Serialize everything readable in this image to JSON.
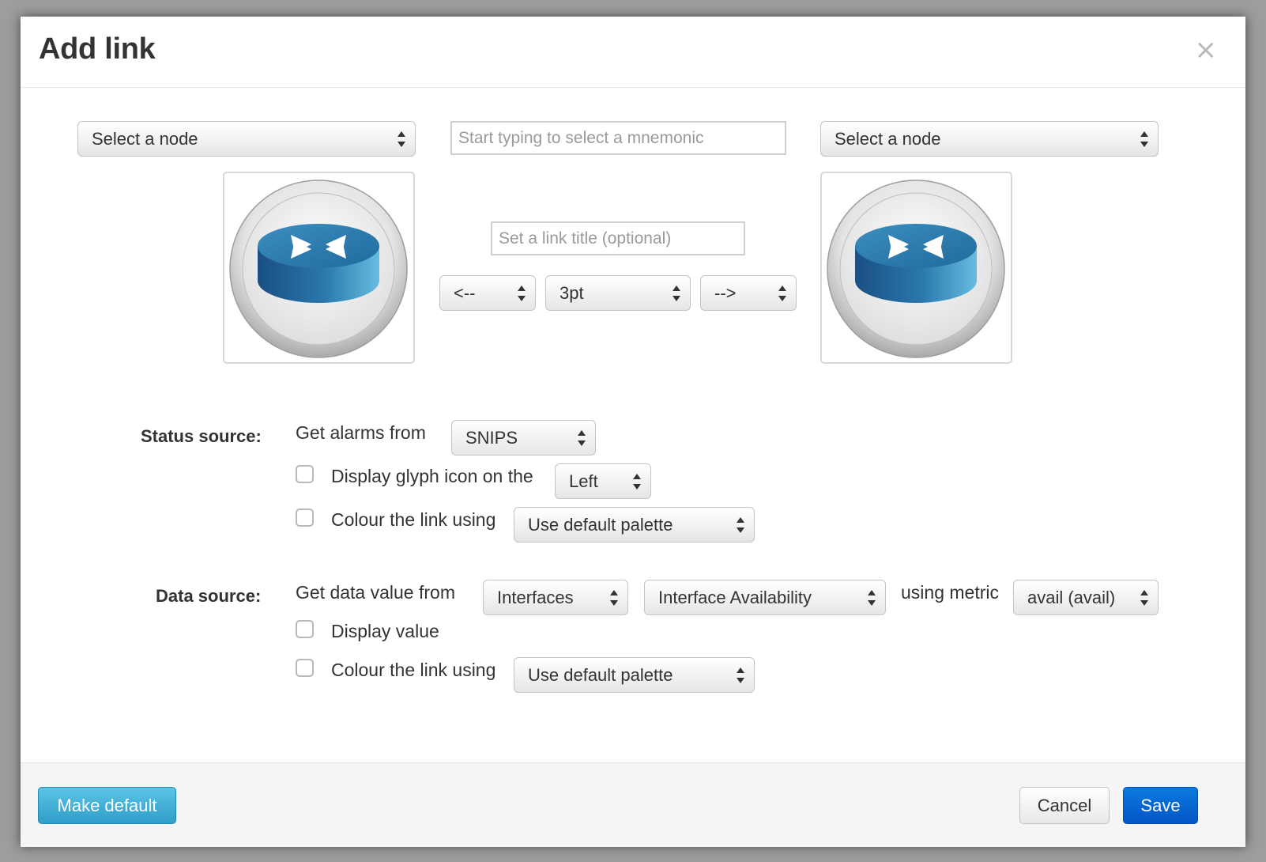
{
  "dialog": {
    "title": "Add link",
    "close_glyph": "×"
  },
  "node_left": {
    "select_label": "Select a node",
    "icon": "router-icon"
  },
  "node_right": {
    "select_label": "Select a node",
    "icon": "router-icon"
  },
  "mnemonic": {
    "placeholder": "Start typing to select a mnemonic",
    "value": ""
  },
  "link_title": {
    "placeholder": "Set a link title (optional)",
    "value": ""
  },
  "link_style": {
    "left_arrow": "<--",
    "width": "3pt",
    "right_arrow": "-->"
  },
  "status_source": {
    "label": "Status source:",
    "get_alarms_text": "Get alarms from",
    "alarm_source": "SNIPS",
    "glyph_checkbox_checked": false,
    "glyph_text": "Display glyph icon on the",
    "glyph_side": "Left",
    "colour_checkbox_checked": false,
    "colour_text": "Colour the link using",
    "colour_palette": "Use default palette"
  },
  "data_source": {
    "label": "Data source:",
    "get_data_text": "Get data value from",
    "source": "Interfaces",
    "item": "Interface Availability",
    "using_metric_text": "using metric",
    "metric": "avail (avail)",
    "display_checkbox_checked": false,
    "display_value_text": "Display value",
    "colour_checkbox_checked": false,
    "colour_text": "Colour the link using",
    "colour_palette": "Use default palette"
  },
  "footer": {
    "make_default_label": "Make default",
    "cancel_label": "Cancel",
    "save_label": "Save"
  },
  "colors": {
    "primary": "#0566d4",
    "info": "#3fb0d8",
    "router_blue": "#2f7cae"
  }
}
